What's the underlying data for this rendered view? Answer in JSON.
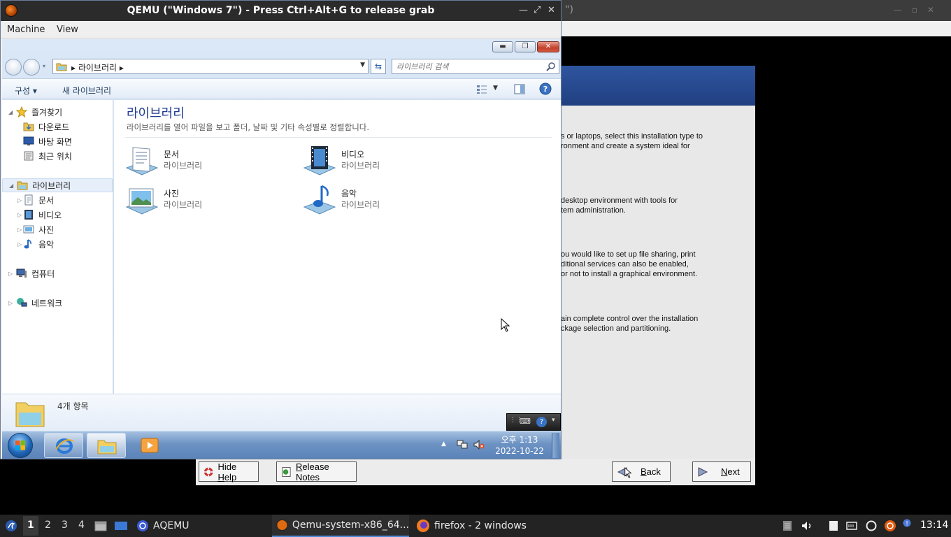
{
  "host_bg_window": {
    "title_fragment": "\")"
  },
  "installer": {
    "paragraphs": [
      [
        "s or laptops, select this installation type to",
        "ronment and create a system ideal for"
      ],
      [
        "desktop environment with tools for",
        "tem administration."
      ],
      [
        "ou would like to set up file sharing, print",
        "ditional services can also be enabled,",
        "or not to install a graphical environment."
      ],
      [
        "ain complete control over the installation",
        "ckage selection and partitioning."
      ]
    ],
    "buttons": {
      "hide_help_pre": "Hide ",
      "hide_help_ul": "H",
      "hide_help_post": "elp",
      "release_notes_pre": "",
      "release_notes_ul": "R",
      "release_notes_post": "elease Notes",
      "back_pre": "",
      "back_ul": "B",
      "back_post": "ack",
      "next_pre": "",
      "next_ul": "N",
      "next_post": "ext"
    }
  },
  "qemu": {
    "title": "QEMU (\"Windows 7\") - Press Ctrl+Alt+G to release grab",
    "menu": [
      "Machine",
      "View"
    ]
  },
  "explorer": {
    "breadcrumb": "▸ 라이브러리 ▸",
    "search_placeholder": "라이브러리 검색",
    "commands": {
      "organize": "구성 ▾",
      "new_library": "새 라이브러리"
    },
    "nav": {
      "favorites": "즐겨찾기",
      "downloads": "다운로드",
      "desktop": "바탕 화면",
      "recent": "최근 위치",
      "libraries": "라이브러리",
      "documents": "문서",
      "videos": "비디오",
      "pictures": "사진",
      "music": "음악",
      "computer": "컴퓨터",
      "network": "네트워크"
    },
    "content": {
      "title": "라이브러리",
      "description": "라이브러리를 열어 파일을 보고 폴더, 날짜 및 기타 속성별로 정렬합니다.",
      "items": [
        {
          "name": "문서",
          "type": "라이브러리",
          "icon": "documents-library-icon"
        },
        {
          "name": "비디오",
          "type": "라이브러리",
          "icon": "videos-library-icon"
        },
        {
          "name": "사진",
          "type": "라이브러리",
          "icon": "pictures-library-icon"
        },
        {
          "name": "음악",
          "type": "라이브러리",
          "icon": "music-library-icon"
        }
      ]
    },
    "details": {
      "count": "4개 항목"
    }
  },
  "win7_taskbar": {
    "clock_time": "오후 1:13",
    "clock_date": "2022-10-22"
  },
  "host_panel": {
    "workspaces": [
      "1",
      "2",
      "3",
      "4"
    ],
    "launcher_label": "AQEMU",
    "tasks": [
      "Qemu-system-x86_64...",
      "firefox - 2 windows"
    ],
    "time": "13:14"
  },
  "colors": {
    "win7_title_blue": "#1e3b8e",
    "host_panel": "#232323",
    "installer_banner": "#2f55a0"
  }
}
